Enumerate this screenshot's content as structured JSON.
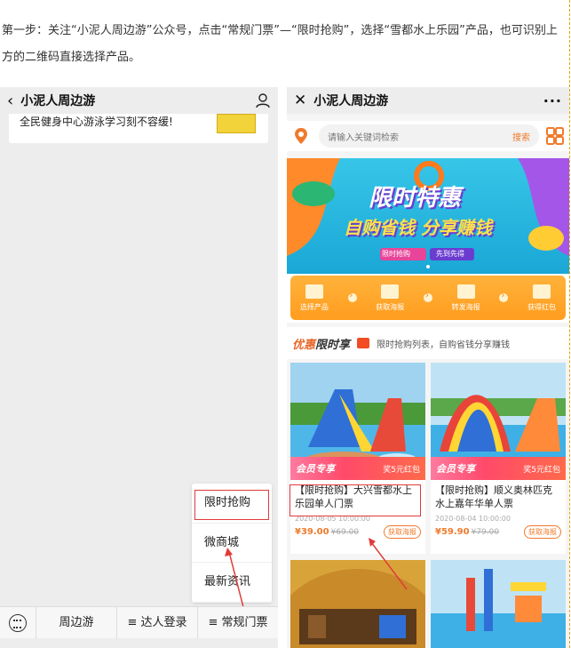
{
  "instruction": "第一步：关注“小泥人周边游”公众号，点击“常规门票”—“限时抢购”，选择“雪都水上乐园”产品，也可识别上方的二维码直接选择产品。",
  "left": {
    "header": {
      "back_icon": "‹",
      "title": "小泥人周边游"
    },
    "article_text": "全民健身中心游泳学习刻不容缓!",
    "popup_items": [
      "限时抢购",
      "微商城",
      "最新资讯"
    ],
    "menu": [
      "周边游",
      "≡ 达人登录",
      "≡ 常规门票"
    ]
  },
  "right": {
    "header": {
      "close_icon": "✕",
      "title": "小泥人周边游",
      "more": "···"
    },
    "search": {
      "placeholder": "请输入关键词检索",
      "button": "搜索"
    },
    "banner": {
      "line1": "限时特惠",
      "line2": "自购省钱 分享赚钱",
      "tag1": "限时抢购",
      "tag2": "先到先得"
    },
    "steps": [
      "选择产品",
      "获取海报",
      "转发海报",
      "获得红包"
    ],
    "section": {
      "title_a": "优惠",
      "title_b": "限时享",
      "desc": "限时抢购列表，自购省钱分享赚钱"
    },
    "cards": [
      {
        "brand": "会员专享",
        "reward": "奖5元红包",
        "name": "【限时抢购】大兴雪都水上乐园单人门票",
        "date": "2020-08-05 10:00:00",
        "price": "¥39.00",
        "old": "¥69.00",
        "btn": "获取海报"
      },
      {
        "brand": "会员专享",
        "reward": "奖5元红包",
        "name": "【限时抢购】顺义奥林匹克水上嘉年华单人票",
        "date": "2020-08-04 10:00:00",
        "price": "¥59.90",
        "old": "¥79.00",
        "btn": "获取海报"
      }
    ]
  },
  "colors": {
    "accent": "#f07a2a",
    "highlight": "#e23a3a",
    "steps_bar": "#ffa62b"
  }
}
